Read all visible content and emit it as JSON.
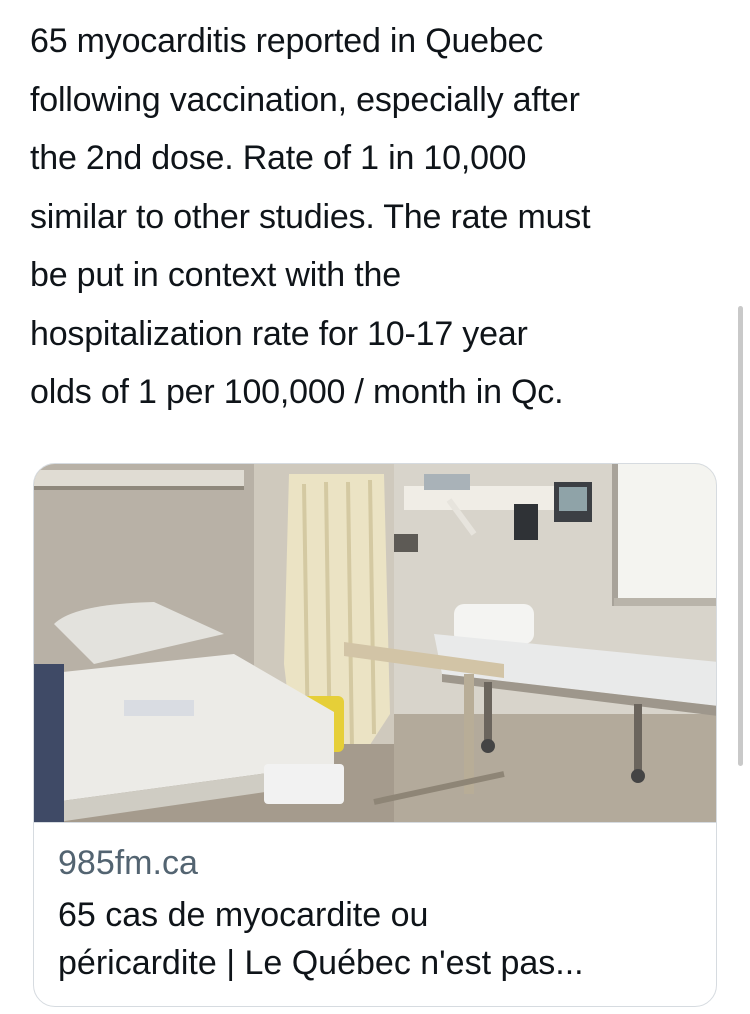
{
  "tweet": {
    "text": "65 myocarditis reported in Quebec\nfollowing vaccination, especially after\nthe 2nd dose. Rate of 1 in 10,000\nsimilar to other studies. The rate must\nbe put in context with the\nhospitalization rate for 10-17 year\nolds of 1 per 100,000 / month in Qc."
  },
  "link_card": {
    "image_description_icon": "hospital-room-photo",
    "domain": "985fm.ca",
    "title": "65 cas de myocardite ou\npéricardite | Le Québec n'est pas..."
  },
  "colors": {
    "text": "#0f1419",
    "secondary_text": "#536471",
    "card_border": "#d6dbe0"
  }
}
